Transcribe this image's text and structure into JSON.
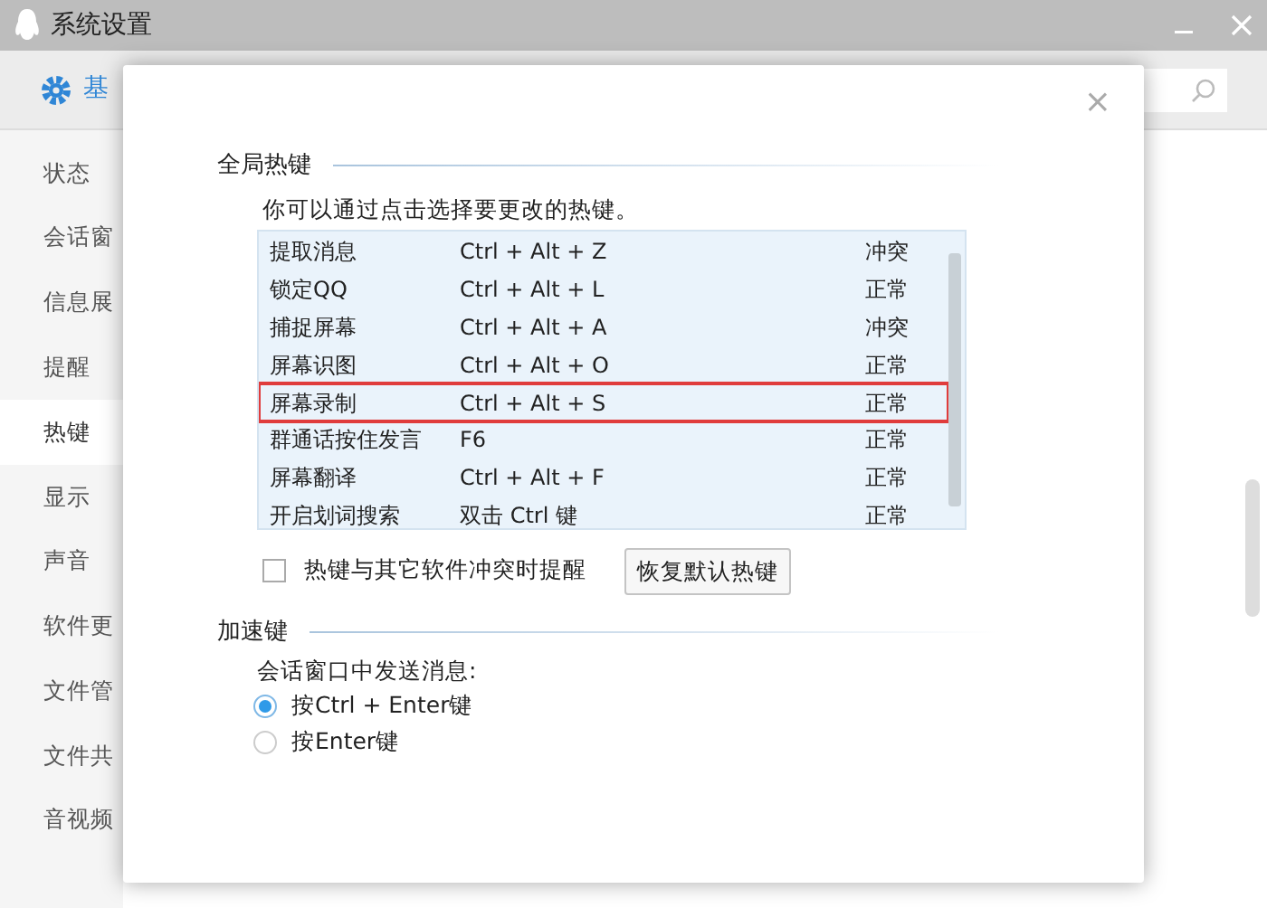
{
  "window": {
    "title": "系统设置"
  },
  "toolbar": {
    "tab": "基"
  },
  "sidebar": {
    "items": [
      {
        "label": "状态",
        "selected": false
      },
      {
        "label": "会话窗",
        "selected": false
      },
      {
        "label": "信息展",
        "selected": false
      },
      {
        "label": "提醒",
        "selected": false
      },
      {
        "label": "热键",
        "selected": true
      },
      {
        "label": "显示",
        "selected": false
      },
      {
        "label": "声音",
        "selected": false
      },
      {
        "label": "软件更",
        "selected": false
      },
      {
        "label": "文件管",
        "selected": false
      },
      {
        "label": "文件共",
        "selected": false
      },
      {
        "label": "音视频",
        "selected": false
      }
    ]
  },
  "dialog": {
    "close": "×",
    "global_hotkeys": {
      "title": "全局热键",
      "hint": "你可以通过点击选择要更改的热键。",
      "rows": [
        {
          "name": "提取消息",
          "keys": "Ctrl + Alt + Z",
          "status": "冲突",
          "highlighted": false
        },
        {
          "name": "锁定QQ",
          "keys": "Ctrl + Alt + L",
          "status": "正常",
          "highlighted": false
        },
        {
          "name": "捕捉屏幕",
          "keys": "Ctrl + Alt + A",
          "status": "冲突",
          "highlighted": false
        },
        {
          "name": "屏幕识图",
          "keys": "Ctrl + Alt + O",
          "status": "正常",
          "highlighted": false
        },
        {
          "name": "屏幕录制",
          "keys": "Ctrl + Alt + S",
          "status": "正常",
          "highlighted": true
        },
        {
          "name": "群通话按住发言",
          "keys": "F6",
          "status": "正常",
          "highlighted": false
        },
        {
          "name": "屏幕翻译",
          "keys": "Ctrl + Alt + F",
          "status": "正常",
          "highlighted": false
        },
        {
          "name": "开启划词搜索",
          "keys": "双击 Ctrl 键",
          "status": "正常",
          "highlighted": false
        }
      ],
      "conflict_alert": {
        "label": "热键与其它软件冲突时提醒",
        "checked": false
      },
      "restore_button": "恢复默认热键"
    },
    "accelerator": {
      "title": "加速键",
      "prompt": "会话窗口中发送消息:",
      "options": [
        {
          "label": "按Ctrl + Enter键",
          "selected": true
        },
        {
          "label": "按Enter键",
          "selected": false
        }
      ]
    }
  }
}
